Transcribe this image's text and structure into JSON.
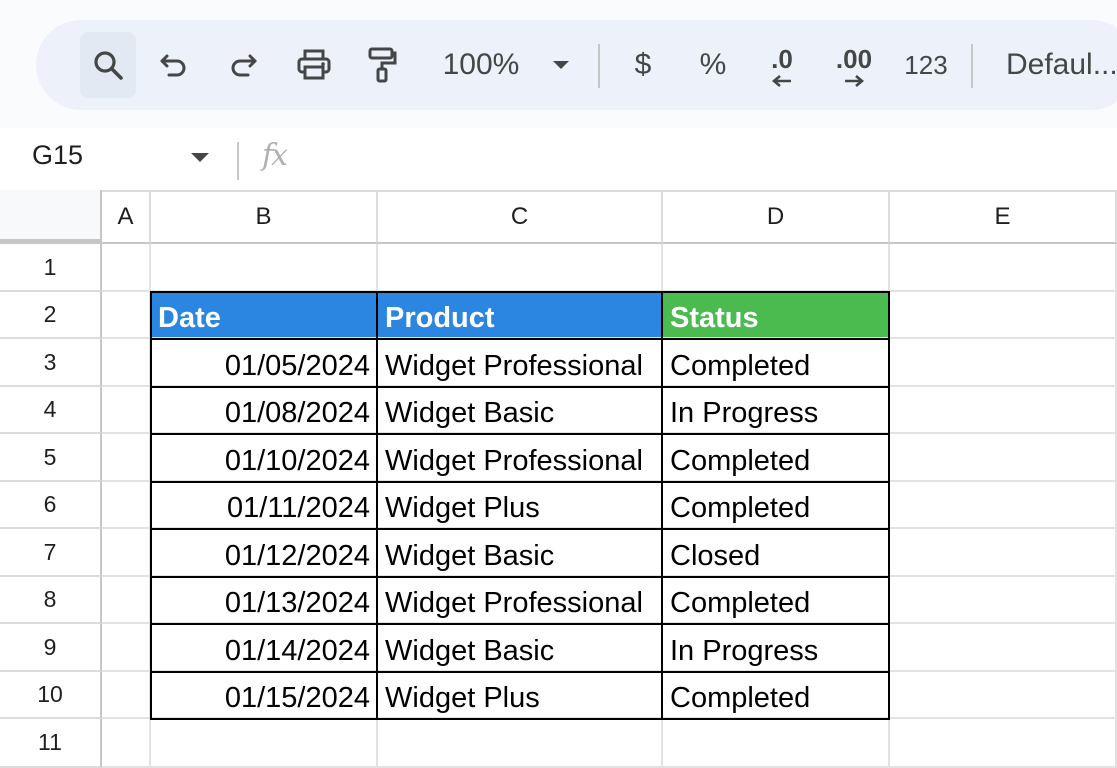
{
  "toolbar": {
    "zoom": "100%",
    "currency_label": "$",
    "percent_label": "%",
    "decrease_decimal_label": ".0",
    "increase_decimal_label": ".00",
    "more_formats_label": "123",
    "font_label": "Defaul..."
  },
  "formula_bar": {
    "cell_ref": "G15",
    "fx_label": "fx"
  },
  "columns": [
    "A",
    "B",
    "C",
    "D",
    "E"
  ],
  "rows": [
    "1",
    "2",
    "3",
    "4",
    "5",
    "6",
    "7",
    "8",
    "9",
    "10",
    "11"
  ],
  "table": {
    "headers": [
      "Date",
      "Product",
      "Status"
    ],
    "rows": [
      [
        "01/05/2024",
        "Widget Professional",
        "Completed"
      ],
      [
        "01/08/2024",
        "Widget Basic",
        "In Progress"
      ],
      [
        "01/10/2024",
        "Widget Professional",
        "Completed"
      ],
      [
        "01/11/2024",
        "Widget Plus",
        "Completed"
      ],
      [
        "01/12/2024",
        "Widget Basic",
        "Closed"
      ],
      [
        "01/13/2024",
        "Widget Professional",
        "Completed"
      ],
      [
        "01/14/2024",
        "Widget Basic",
        "In Progress"
      ],
      [
        "01/15/2024",
        "Widget Plus",
        "Completed"
      ]
    ]
  },
  "colors": {
    "header_blue": "#2b86e1",
    "header_green": "#4cbb4f",
    "toolbar_bg": "#edf2fa"
  }
}
